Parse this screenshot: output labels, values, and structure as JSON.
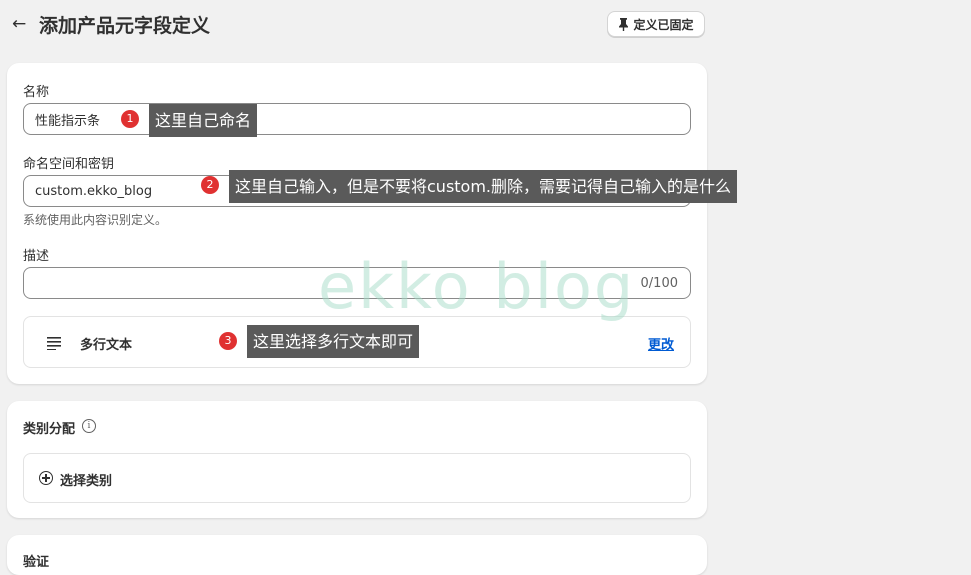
{
  "header": {
    "back_icon": "arrow-left-icon",
    "title": "添加产品元字段定义",
    "pin_button": "定义已固定",
    "pin_icon": "pin-icon"
  },
  "form": {
    "name_label": "名称",
    "name_value": "性能指示条",
    "namespace_label": "命名空间和密钥",
    "namespace_value": "custom.ekko_blog",
    "namespace_hint": "系统使用此内容识别定义。",
    "description_label": "描述",
    "description_value": "",
    "description_counter": "0/100",
    "type_icon": "text-lines-icon",
    "type_label": "多行文本",
    "type_change": "更改"
  },
  "category": {
    "title": "类别分配",
    "info_icon": "info-icon",
    "select_icon": "plus-circle-icon",
    "select_label": "选择类别"
  },
  "validation": {
    "title": "验证"
  },
  "annotations": [
    {
      "number": "1",
      "text": "这里自己命名"
    },
    {
      "number": "2",
      "text": "这里自己输入，但是不要将custom.删除，需要记得自己输入的是什么"
    },
    {
      "number": "3",
      "text": "这里选择多行文本即可"
    }
  ],
  "watermark": "ekko blog",
  "colors": {
    "link": "#005bd3",
    "badge": "#e03131",
    "note_bg": "#5a5a5a",
    "page_bg": "#f1f1f1"
  }
}
